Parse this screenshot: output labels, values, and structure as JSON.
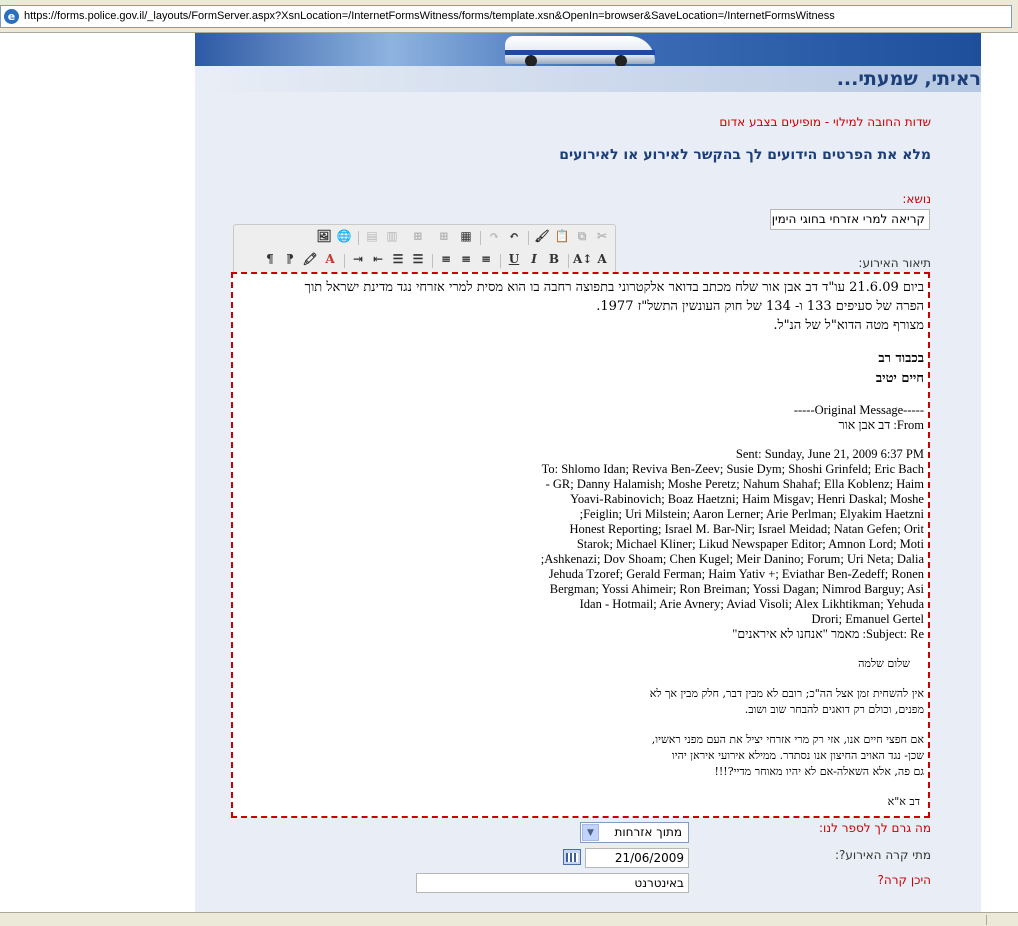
{
  "browser": {
    "url": "https://forms.police.gov.il/_layouts/FormServer.aspx?XsnLocation=/InternetFormsWitness/forms/template.xsn&OpenIn=browser&SaveLocation=/InternetFormsWitness"
  },
  "header": {
    "title": "ראיתי, שמעתי..."
  },
  "form": {
    "required_note": "שדות החובה למילוי - מופיעים בצבע אדום",
    "instruction": "מלא את הפרטים הידועים לך בהקשר לאירוע או לאירועים",
    "subject_label": "נושא:",
    "subject_value": "קריאה למרי אזרחי בחוגי הימין",
    "description_label": "תיאור האירוע:",
    "reason_label": "מה גרם לך לספר לנו:",
    "reason_value": "מתוך אזרחות",
    "when_label": "מתי קרה האירוע?:",
    "when_value": "21/06/2009",
    "where_label": "היכן קרה?",
    "where_value": "באינטרנט"
  },
  "editor": {
    "para1_lines": [
      "ביום 21.6.09 עו\"ד דב אבן אור שלח מכתב בדואר אלקטרוני בתפוצה רחבה בו הוא מסית למרי אזרחי נגד מדינת ישראל תוך",
      "הפרה של סעיפים 133 ו- 134 של חוק העונשין התשל\"ז 1977.",
      "מצורף מטה הדוא\"ל של הנ\"ל."
    ],
    "sign1": "בכבוד רב",
    "sign2": "חיים יטיב",
    "orig_msg": "-----Original Message-----",
    "from_line": "From: דב אבן אור",
    "sent_line": "Sent: Sunday, June 21, 2009 6:37 PM",
    "to_lines": [
      "To: Shlomo Idan; Reviva Ben-Zeev; Susie Dym; Shoshi Grinfeld; Eric Bach",
      "GR; Danny Halamish; Moshe Peretz; Nahum Shahaf; Ella Koblenz; Haim -",
      "Yoavi-Rabinovich; Boaz Haetzni; Haim Misgav; Henri Daskal; Moshe",
      "Feiglin; Uri Milstein; Aaron Lerner; Arie Perlman; Elyakim Haetzni;",
      "Honest Reporting; Israel M. Bar-Nir; Israel Meidad; Natan Gefen; Orit",
      "Starok; Michael Kliner; Likud Newspaper Editor; Amnon Lord; Moti",
      "Ashkenazi; Dov Shoam; Chen Kugel; Meir Danino; Forum; Uri Neta; Dalia;",
      "Jehuda Tzoref; Gerald Ferman; Haim Yativ +; Eviathar Ben-Zedeff; Ronen",
      "Bergman; Yossi Ahimeir; Ron Breiman; Yossi Dagan; Nimrod Barguy; Asi",
      "Idan - Hotmail; Arie Avnery; Aviad Visoli; Alex Likhtikman; Yehuda",
      "Drori; Emanuel Gertel"
    ],
    "subject_line": "Subject: Re: מאמר \"אנחנו לא איראנים\"",
    "greeting": "שלום שלמה",
    "body1_lines": [
      "אין להשחית זמן אצל הה\"כ; רובם לא מבין דבר, חלק מבין אך לא",
      "מפנים, וכולם רק דואגים להבחר שוב ושוב."
    ],
    "body2_lines": [
      "אם חפצי חיים אנו, אזי רק מרי אזרחי יציל את העם מפני ראשיו,",
      "שכן- נגד האויב החיצון אנו נסתדר. ממילא אירועי איראן יהיו",
      "גם פה, אלא השאלה-אם לא יהיו מאוחר מדיי?!!!"
    ],
    "closing": "דב א\"א"
  }
}
